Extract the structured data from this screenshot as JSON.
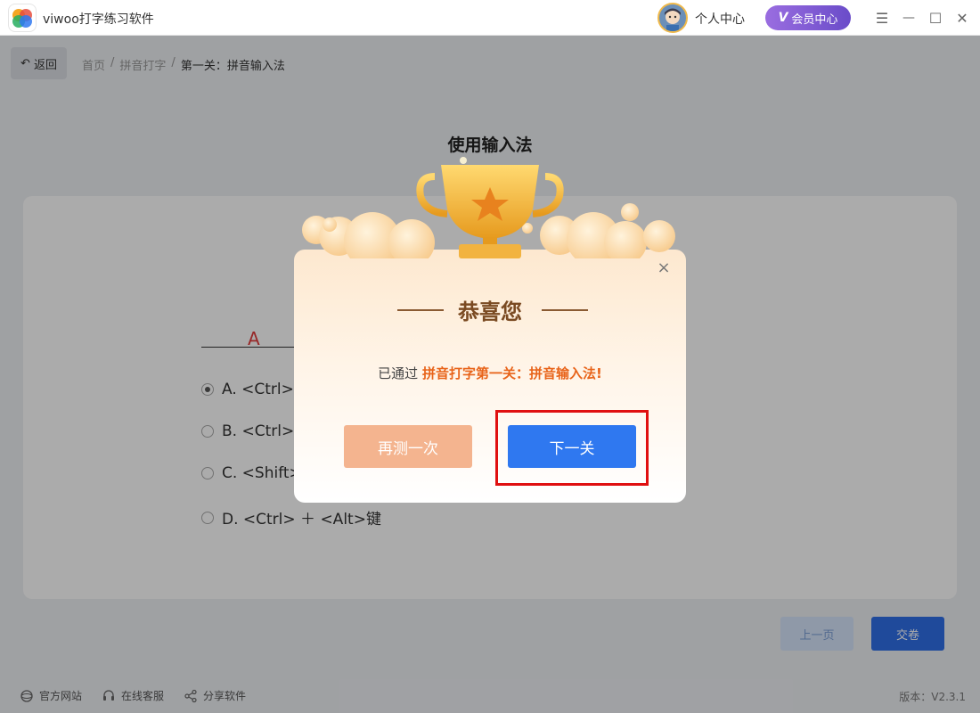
{
  "app": {
    "title": "viwoo打字练习软件"
  },
  "header": {
    "personal_center": "个人中心",
    "vip_center": "会员中心",
    "vip_mark": "V"
  },
  "window_controls": {
    "menu": "☰",
    "minimize": "—",
    "maximize": "☐",
    "close": "✕"
  },
  "nav": {
    "back_label": "返回",
    "back_icon": "↶",
    "breadcrumb": [
      "首页",
      "拼音打字",
      "第一关：拼音输入法"
    ],
    "separator": "/"
  },
  "quiz": {
    "title": "使用输入法",
    "answer": "A",
    "options": [
      {
        "label": "A. <Ctrl>",
        "selected": true
      },
      {
        "label": "B. <Ctrl>",
        "selected": false
      },
      {
        "label": "C. <Shift>",
        "selected": false
      },
      {
        "label": "D. <Ctrl> ＋ <Alt>键",
        "selected": false
      }
    ],
    "prev_label": "上一页",
    "submit_label": "交卷"
  },
  "footer": {
    "website": "官方网站",
    "support": "在线客服",
    "share": "分享软件",
    "version": "版本：V2.3.1"
  },
  "modal": {
    "heading": "恭喜您",
    "message_prefix": "已通过",
    "message_highlight": "拼音打字第一关：拼音输入法!",
    "retry_label": "再测一次",
    "next_label": "下一关",
    "close_icon": "×"
  },
  "colors": {
    "accent_blue": "#2f78f0",
    "accent_orange": "#e8641a",
    "retry_orange": "#f4b48f",
    "highlight_red": "#e01010",
    "vip_purple": "#7d5ad6"
  }
}
